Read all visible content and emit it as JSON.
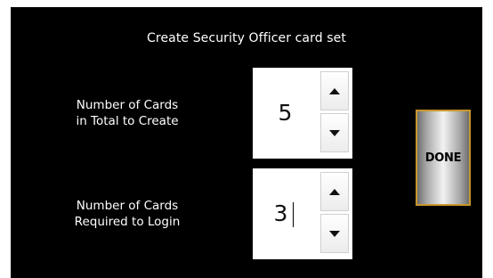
{
  "dialog": {
    "title": "Create Security Officer card set"
  },
  "total_cards": {
    "label_line1": "Number of Cards",
    "label_line2": "in Total to Create",
    "value": "5"
  },
  "required_cards": {
    "label_line1": "Number of Cards",
    "label_line2": "Required to Login",
    "value": "3"
  },
  "actions": {
    "done_label": "DONE"
  },
  "icons": {
    "increment": "triangle-up-icon",
    "decrement": "triangle-down-icon"
  },
  "colors": {
    "background": "#000000",
    "text": "#ffffff",
    "done_border": "#c8962d"
  }
}
